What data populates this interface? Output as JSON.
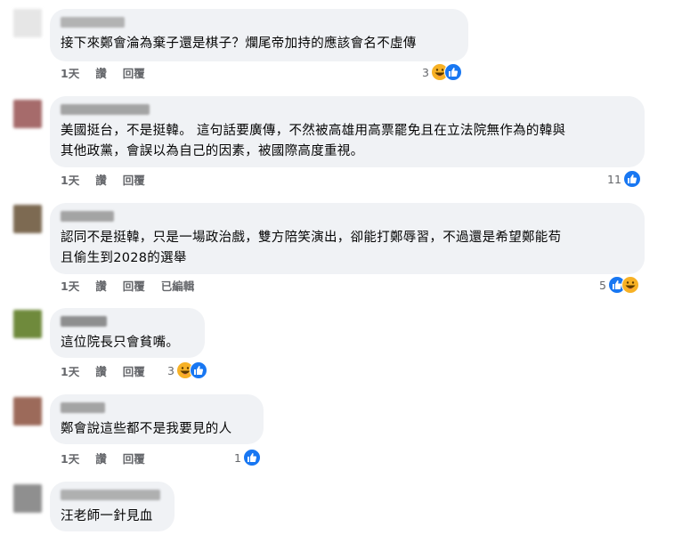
{
  "comments": [
    {
      "text": "接下來鄭會淪為棄子還是棋子？爛尾帝加持的應該會名不虛傳",
      "time": "1天",
      "like_label": "讚",
      "reply_label": "回覆",
      "edited_label": "",
      "reaction_count": "3",
      "reactions": [
        "haha-icon",
        "like-icon"
      ],
      "avatar_color": "#e6e6e6",
      "author_color": "#9e9e9e"
    },
    {
      "text": "美國挺台，不是挺韓。 這句話要廣傳，不然被高雄用高票罷免且在立法院無作為的韓與\n其他政黨，會誤以為自己的因素，被國際高度重視。",
      "time": "1天",
      "like_label": "讚",
      "reply_label": "回覆",
      "edited_label": "",
      "reaction_count": "11",
      "reactions": [
        "like-icon"
      ],
      "avatar_color": "#a66b6b",
      "author_color": "#8a8a8a"
    },
    {
      "text": "認同不是挺韓，只是一場政治戲，雙方陪笑演出，卻能打鄭辱習，不過還是希望鄭能苟\n且偷生到2028的選舉",
      "time": "1天",
      "like_label": "讚",
      "reply_label": "回覆",
      "edited_label": "已編輯",
      "reaction_count": "5",
      "reactions": [
        "like-icon",
        "haha-icon"
      ],
      "avatar_color": "#7d6a52",
      "author_color": "#8a8a8a"
    },
    {
      "text": "這位院長只會貧嘴。",
      "time": "1天",
      "like_label": "讚",
      "reply_label": "回覆",
      "edited_label": "",
      "reaction_count": "3",
      "reactions": [
        "haha-icon",
        "like-icon"
      ],
      "avatar_color": "#6f8a3c",
      "author_color": "#6e6e6e"
    },
    {
      "text": "鄭會說這些都不是我要見的人",
      "time": "1天",
      "like_label": "讚",
      "reply_label": "回覆",
      "edited_label": "",
      "reaction_count": "1",
      "reactions": [
        "like-icon"
      ],
      "avatar_color": "#9c6a5a",
      "author_color": "#8a8a8a"
    },
    {
      "text": "汪老師一針見血",
      "time": "",
      "like_label": "",
      "reply_label": "",
      "edited_label": "",
      "reaction_count": "",
      "reactions": [],
      "avatar_color": "#8f8f8f",
      "author_color": "#9a9a9a"
    }
  ],
  "colors": {
    "like_blue": "#1877f2",
    "haha_yellow": "#f7b125",
    "bubble_bg": "#f0f2f5",
    "meta_gray": "#65676b"
  }
}
